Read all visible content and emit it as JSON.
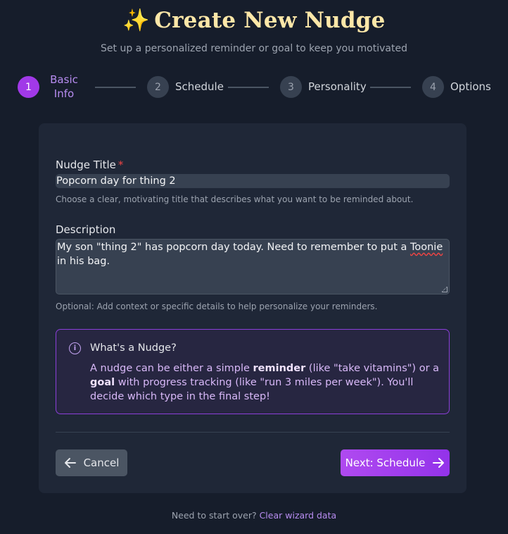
{
  "header": {
    "sparkle_icon": "✨",
    "title": "Create New Nudge",
    "subtitle": "Set up a personalized reminder or goal to keep you motivated"
  },
  "stepper": {
    "steps": [
      {
        "number": "1",
        "label": "Basic Info",
        "active": true
      },
      {
        "number": "2",
        "label": "Schedule",
        "active": false
      },
      {
        "number": "3",
        "label": "Personality",
        "active": false
      },
      {
        "number": "4",
        "label": "Options",
        "active": false
      }
    ]
  },
  "form": {
    "title_field": {
      "label": "Nudge Title",
      "required_mark": "*",
      "value": "Popcorn day for thing 2",
      "help": "Choose a clear, motivating title that describes what you want to be reminded about."
    },
    "description_field": {
      "label": "Description",
      "value_before": "My son \"thing 2\" has popcorn day today. Need to remember to put a ",
      "value_misspelled": "Toonie",
      "value_after": " in his bag.",
      "help": "Optional: Add context or specific details to help personalize your reminders."
    }
  },
  "info_box": {
    "icon": "info-icon",
    "title": "What's a Nudge?",
    "text_1": "A nudge can be either a simple ",
    "bold_1": "reminder",
    "text_2": " (like \"take vitamins\") or a ",
    "bold_2": "goal",
    "text_3": " with progress tracking (like \"run 3 miles per week\"). You'll decide which type in the final step!"
  },
  "actions": {
    "cancel_label": "Cancel",
    "next_label": "Next: Schedule"
  },
  "footer": {
    "prompt": "Need to start over?",
    "link": "Clear wizard data"
  },
  "colors": {
    "background": "#161d2b",
    "card": "#1f2737",
    "accent": "#a139e8",
    "title": "#fde7a8"
  }
}
